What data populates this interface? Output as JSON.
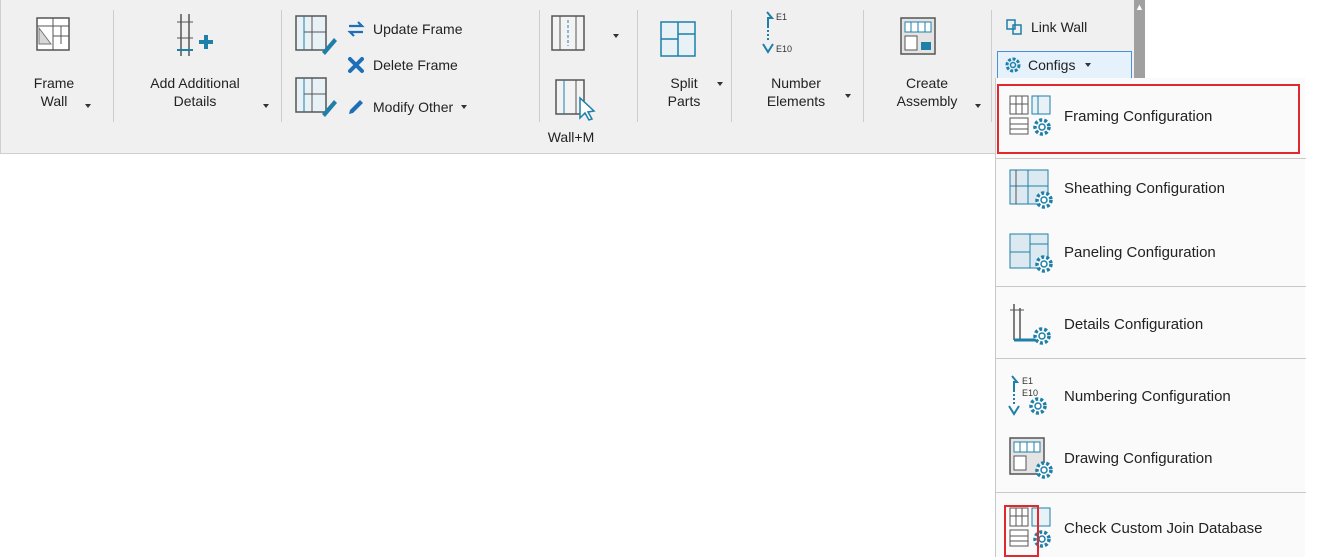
{
  "ribbon": {
    "frame_wall": {
      "line1": "Frame",
      "line2": "Wall"
    },
    "add_details": {
      "line1": "Add Additional",
      "line2": "Details"
    },
    "update_frame": "Update Frame",
    "delete_frame": "Delete Frame",
    "modify_other": "Modify Other",
    "wall_m_label": "Wall+M",
    "split_parts": {
      "line1": "Split",
      "line2": "Parts"
    },
    "number_elements": {
      "line1": "Number",
      "line2": "Elements",
      "e1": "E1",
      "e10": "E10"
    },
    "create_assembly": {
      "line1": "Create",
      "line2": "Assembly"
    },
    "link_wall": "Link Wall",
    "configs": "Configs"
  },
  "menu": {
    "items": [
      {
        "label": "Framing Configuration"
      },
      {
        "label": "Sheathing Configuration"
      },
      {
        "label": "Paneling Configuration"
      },
      {
        "label": "Details Configuration"
      },
      {
        "label": "Numbering Configuration",
        "e1": "E1",
        "e10": "E10"
      },
      {
        "label": "Drawing Configuration"
      },
      {
        "label": "Check Custom Join Database"
      }
    ]
  },
  "colors": {
    "accent": "#1e7fa8",
    "highlight": "#e0282e",
    "ribbon_bg": "#f0f0f0"
  }
}
